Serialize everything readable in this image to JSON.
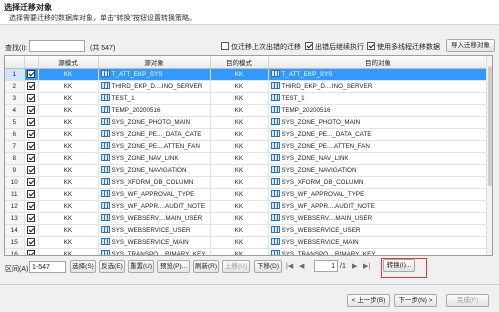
{
  "dialog": {
    "title": "选择迁移对象",
    "subtitle": "选择需要迁移的数据库对象，单击\"转换\"按钮设置转换策略。"
  },
  "toolbar": {
    "find_label": "查找(I):",
    "find_value": "",
    "count": "(共 547)",
    "only_last_failed": "仅迁移上次出错的迁移",
    "create_after_fail": "出错后继续执行",
    "use_multithread": "使用多线程迁移数据",
    "import_button": "导入迁移对象"
  },
  "table": {
    "columns": [
      "",
      "",
      "源模式",
      "源对象",
      "目的模式",
      "目的对象"
    ],
    "rows": [
      {
        "num": "1",
        "checked": true,
        "src_schema": "KK",
        "src_object": "T_ATT_EKP_SYS",
        "dst_schema": "KK",
        "dst_object": "T_ATT_EKP_SYS",
        "selected": true
      },
      {
        "num": "2",
        "checked": true,
        "src_schema": "KK",
        "src_object": "THIRD_EKP_D....INO_SERVER",
        "dst_schema": "KK",
        "dst_object": "THIRD_EKP_D....INO_SERVER",
        "selected": false
      },
      {
        "num": "3",
        "checked": true,
        "src_schema": "KK",
        "src_object": "TEST_1",
        "dst_schema": "KK",
        "dst_object": "TEST_1",
        "selected": false
      },
      {
        "num": "4",
        "checked": true,
        "src_schema": "KK",
        "src_object": "TEMP_20200516",
        "dst_schema": "KK",
        "dst_object": "TEMP_20200516",
        "selected": false
      },
      {
        "num": "5",
        "checked": true,
        "src_schema": "KK",
        "src_object": "SYS_ZONE_PHOTO_MAIN",
        "dst_schema": "KK",
        "dst_object": "SYS_ZONE_PHOTO_MAIN",
        "selected": false
      },
      {
        "num": "6",
        "checked": true,
        "src_schema": "KK",
        "src_object": "SYS_ZONE_PE..._DATA_CATE",
        "dst_schema": "KK",
        "dst_object": "SYS_ZONE_PE..._DATA_CATE",
        "selected": false
      },
      {
        "num": "7",
        "checked": true,
        "src_schema": "KK",
        "src_object": "SYS_ZONE_PE....ATTEN_FAN",
        "dst_schema": "KK",
        "dst_object": "SYS_ZONE_PE....ATTEN_FAN",
        "selected": false
      },
      {
        "num": "8",
        "checked": true,
        "src_schema": "KK",
        "src_object": "SYS_ZONE_NAV_LINK",
        "dst_schema": "KK",
        "dst_object": "SYS_ZONE_NAV_LINK",
        "selected": false
      },
      {
        "num": "9",
        "checked": true,
        "src_schema": "KK",
        "src_object": "SYS_ZONE_NAVIGATION",
        "dst_schema": "KK",
        "dst_object": "SYS_ZONE_NAVIGATION",
        "selected": false
      },
      {
        "num": "10",
        "checked": true,
        "src_schema": "KK",
        "src_object": "SYS_XFORM_DB_COLUMN",
        "dst_schema": "KK",
        "dst_object": "SYS_XFORM_DB_COLUMN",
        "selected": false
      },
      {
        "num": "11",
        "checked": true,
        "src_schema": "KK",
        "src_object": "SYS_WF_APPROVAL_TYPE",
        "dst_schema": "KK",
        "dst_object": "SYS_WF_APPROVAL_TYPE",
        "selected": false
      },
      {
        "num": "12",
        "checked": true,
        "src_schema": "KK",
        "src_object": "SYS_WF_APPR....AUDIT_NOTE",
        "dst_schema": "KK",
        "dst_object": "SYS_WF_APPR....AUDIT_NOTE",
        "selected": false
      },
      {
        "num": "13",
        "checked": true,
        "src_schema": "KK",
        "src_object": "SYS_WEBSERV....MAIN_USER",
        "dst_schema": "KK",
        "dst_object": "SYS_WEBSERV....MAIN_USER",
        "selected": false
      },
      {
        "num": "14",
        "checked": true,
        "src_schema": "KK",
        "src_object": "SYS_WEBSERVICE_USER",
        "dst_schema": "KK",
        "dst_object": "SYS_WEBSERVICE_USER",
        "selected": false
      },
      {
        "num": "15",
        "checked": true,
        "src_schema": "KK",
        "src_object": "SYS_WEBSERVICE_MAIN",
        "dst_schema": "KK",
        "dst_object": "SYS_WEBSERVICE_MAIN",
        "selected": false
      },
      {
        "num": "16",
        "checked": true,
        "src_schema": "KK",
        "src_object": "SYS_TRANSPO....RIMARY_KEY",
        "dst_schema": "KK",
        "dst_object": "SYS_TRANSPO....RIMARY_KEY",
        "selected": false
      }
    ]
  },
  "bottom_bar": {
    "range_label": "区间(A):",
    "range_value": "1-547",
    "select": "选择(S)",
    "invert": "反选(E)",
    "reset": "重置(U)",
    "preview": "预览(P)...",
    "refresh": "刷新(R)",
    "move_up": "上移(U)",
    "move_down": "下移(D)",
    "page_value": "1",
    "page_total": "/1",
    "convert": "转换(I)..."
  },
  "footer": {
    "back": "< 上一步(B)",
    "next": "下一步(N) >",
    "finish": "完成(F)"
  },
  "colors": {
    "selection": "#3399ff",
    "highlight_box": "#e23b3b"
  }
}
